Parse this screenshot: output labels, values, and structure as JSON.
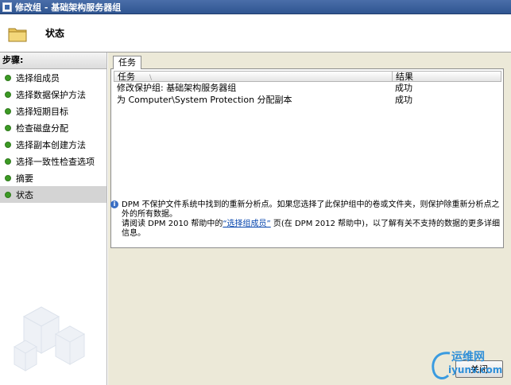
{
  "window": {
    "title": "修改组 - 基础架构服务器组"
  },
  "header": {
    "title": "状态"
  },
  "sidebar": {
    "header": "步骤:",
    "steps": [
      {
        "label": "选择组成员"
      },
      {
        "label": "选择数据保护方法"
      },
      {
        "label": "选择短期目标"
      },
      {
        "label": "检查磁盘分配"
      },
      {
        "label": "选择副本创建方法"
      },
      {
        "label": "选择一致性检查选项"
      },
      {
        "label": "摘要"
      },
      {
        "label": "状态",
        "selected": true
      }
    ]
  },
  "main": {
    "tab_label": "任务",
    "grid": {
      "columns": [
        "任务",
        "结果"
      ],
      "rows": [
        {
          "task": "修改保护组: 基础架构服务器组",
          "result": "成功"
        },
        {
          "task": "为 Computer\\System  Protection 分配副本",
          "result": "成功"
        }
      ]
    },
    "info": {
      "line1": "DPM 不保护文件系统中找到的重新分析点。如果您选择了此保护组中的卷或文件夹，则保护除重新分析点之外的所有数据。",
      "line2_pre": "请阅读 DPM 2010 帮助中的",
      "link": "“选择组成员”",
      "line2_post": " 页(在 DPM 2012 帮助中)，以了解有关不支持的数据的更多详细信息。"
    },
    "close_label": "关闭"
  },
  "watermark": {
    "cn": "运维网",
    "en": "iyunv.com"
  },
  "colors": {
    "status_dot": "#3c9a24",
    "title_bar": "#2f5591",
    "link": "#0645ad"
  }
}
